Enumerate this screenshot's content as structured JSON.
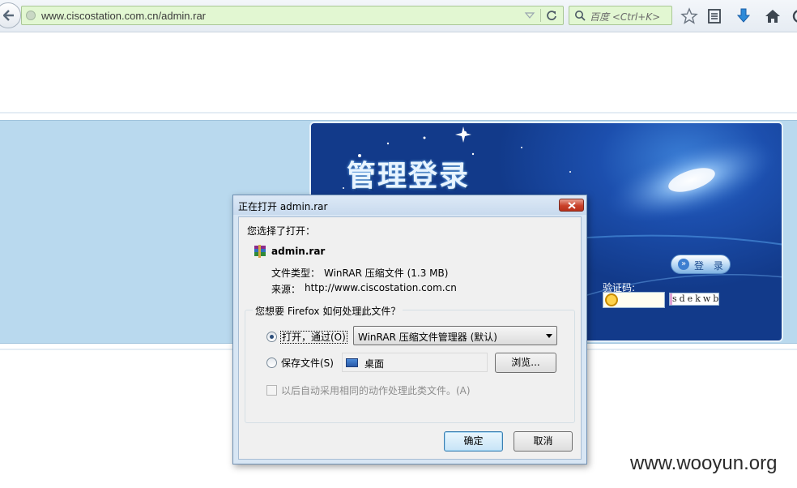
{
  "browser": {
    "url": "www.ciscostation.com.cn/admin.rar",
    "search_placeholder": "百度 <Ctrl+K>"
  },
  "page": {
    "banner_title": "管理登录",
    "login_button": "登 录",
    "captcha_label": "验证码:",
    "captcha_text": "sdekwb"
  },
  "dialog": {
    "title": "正在打开 admin.rar",
    "intro": "您选择了打开：",
    "file_name": "admin.rar",
    "file_type_label": "文件类型：",
    "file_type_value": "WinRAR 压缩文件 (1.3 MB)",
    "source_label": "来源：",
    "source_value": "http://www.ciscostation.com.cn",
    "question": "您想要 Firefox 如何处理此文件？",
    "open_with_label": "打开，通过(O)",
    "open_with_app": "WinRAR 压缩文件管理器 (默认)",
    "save_label": "保存文件(S)",
    "save_location": "桌面",
    "browse_button": "浏览...",
    "auto_label": "以后自动采用相同的动作处理此类文件。(A)",
    "ok_button": "确定",
    "cancel_button": "取消"
  },
  "watermark": "www.wooyun.org",
  "colors": {
    "url_bar_bg": "#e2f7d2",
    "band_bg": "#b9d9ee",
    "banner_bg": "#1c4fae",
    "dialog_frame": "#d8e6f4",
    "close_button": "#c9412a"
  }
}
